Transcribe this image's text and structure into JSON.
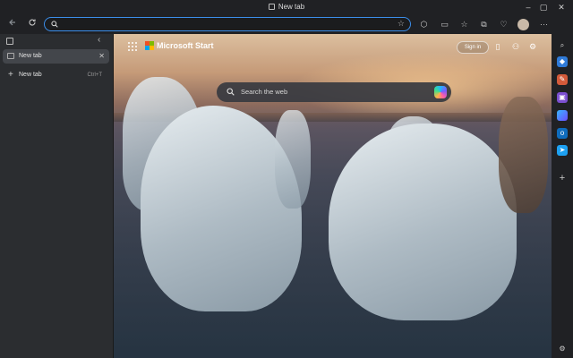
{
  "window": {
    "title": "New tab",
    "controls": {
      "minimize": "–",
      "maximize": "▢",
      "close": "✕"
    }
  },
  "toolbar": {
    "back_icon": "back-arrow-icon",
    "refresh_icon": "refresh-icon",
    "address_value": "",
    "favorite_icon": "star-icon",
    "icons": [
      "extensions-icon",
      "split-screen-icon",
      "favorites-icon",
      "collections-icon",
      "browser-essentials-icon",
      "profile-icon",
      "more-icon",
      "copilot-icon"
    ]
  },
  "sidebar": {
    "tabs": [
      {
        "label": "New tab",
        "active": true
      },
      {
        "label": "New tab",
        "shortcut": "Ctrl+T",
        "is_new_tab_button": true
      }
    ]
  },
  "newtab": {
    "brand": "Microsoft Start",
    "signin_label": "Sign in",
    "search_placeholder": "Search the web"
  },
  "edgebar": {
    "icons": [
      "search-icon",
      "shopping-icon",
      "tools-icon",
      "games-icon",
      "copilot-icon",
      "outlook-icon",
      "send-icon",
      "add-icon",
      "settings-icon"
    ],
    "accent": "#3b8eea"
  }
}
